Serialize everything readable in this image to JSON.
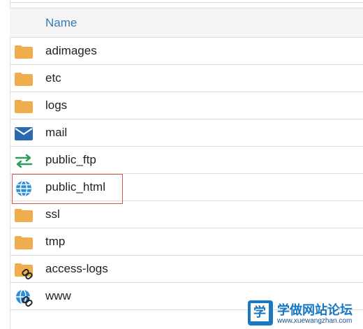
{
  "table": {
    "header": {
      "name_label": "Name"
    },
    "rows": [
      {
        "label": "adimages",
        "icon": "folder-icon"
      },
      {
        "label": "etc",
        "icon": "folder-icon"
      },
      {
        "label": "logs",
        "icon": "folder-icon"
      },
      {
        "label": "mail",
        "icon": "envelope-icon"
      },
      {
        "label": "public_ftp",
        "icon": "transfer-arrows-icon"
      },
      {
        "label": "public_html",
        "icon": "globe-icon",
        "highlighted": true
      },
      {
        "label": "ssl",
        "icon": "folder-icon"
      },
      {
        "label": "tmp",
        "icon": "folder-icon"
      },
      {
        "label": "access-logs",
        "icon": "folder-link-icon"
      },
      {
        "label": "www",
        "icon": "globe-link-icon"
      }
    ]
  },
  "watermark": {
    "logo_char": "学",
    "title": "学做网站论坛",
    "url": "www.xuewangzhan.com"
  },
  "colors": {
    "folder": "#f0ad4e",
    "mail": "#2a6ab0",
    "ftp": "#2ca05a",
    "globe": "#2a8fd6",
    "header_text": "#337ab7",
    "highlight_border": "#d9534f"
  }
}
